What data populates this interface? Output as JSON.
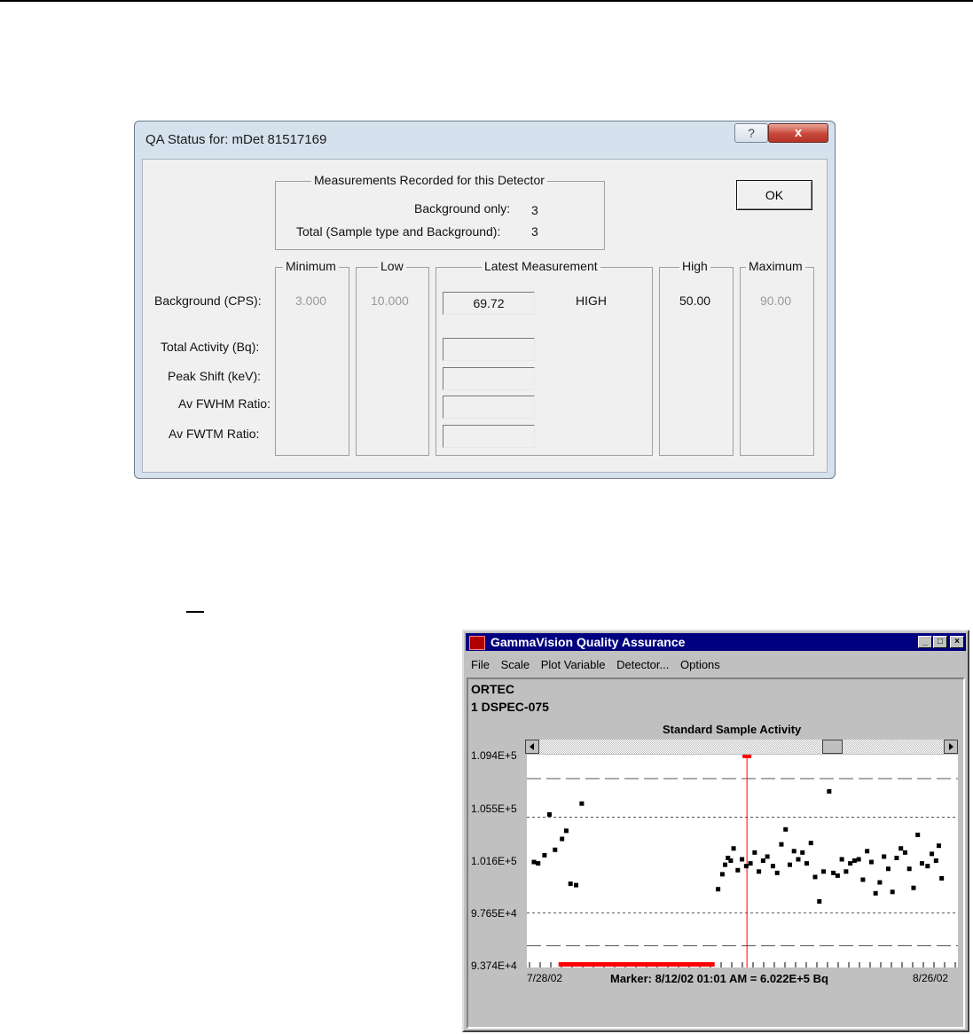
{
  "qa_dialog": {
    "title": "QA Status for: mDet 81517169",
    "help_icon": "?",
    "close_icon": "x",
    "ok_label": "OK",
    "recorded": {
      "caption": "Measurements Recorded for this Detector",
      "background_label": "Background only:",
      "background_value": "3",
      "total_label": "Total (Sample type and Background):",
      "total_value": "3"
    },
    "columns": {
      "minimum": "Minimum",
      "low": "Low",
      "latest": "Latest Measurement",
      "high": "High",
      "maximum": "Maximum"
    },
    "rows": {
      "background": "Background (CPS):",
      "total_activity": "Total Activity (Bq):",
      "peak_shift": "Peak Shift (keV):",
      "av_fwhm": "Av FWHM Ratio:",
      "av_fwtm": "Av FWTM Ratio:"
    },
    "background_values": {
      "minimum": "3.000",
      "low": "10.000",
      "latest": "69.72",
      "status": "HIGH",
      "high": "50.00",
      "maximum": "90.00"
    }
  },
  "gv_window": {
    "title": "GammaVision Quality Assurance",
    "controls": [
      "_",
      "□",
      "×"
    ],
    "menu": [
      "File",
      "Scale",
      "Plot Variable",
      "Detector...",
      "Options"
    ],
    "header_line1": "ORTEC",
    "header_line2": "1 DSPEC-075",
    "marker_text": "Marker: 8/12/02 01:01 AM = 6.022E+5 Bq",
    "colors": {
      "titlebar": "#000080",
      "marker": "#ff0000",
      "plot_bg": "#ffffff"
    }
  },
  "chart_data": {
    "type": "scatter",
    "title": "Standard Sample Activity",
    "y_tick_labels": [
      "1.094E+5",
      "1.055E+5",
      "1.016E+5",
      "9.765E+4",
      "9.374E+4"
    ],
    "ylim": [
      93740,
      109400
    ],
    "x_tick_labels": [
      "7/28/02",
      "8/26/02"
    ],
    "x_range": [
      "7/28/02",
      "8/26/02"
    ],
    "limit_lines": {
      "outer_dashed": [
        107640,
        95340
      ],
      "inner_dotted": [
        104800,
        97760
      ]
    },
    "marker_position": "8/12/02 01:01 AM",
    "series": [
      {
        "x": [
          0,
          0.3,
          0.75,
          1.1,
          1.5,
          2,
          2.3,
          2.6,
          3,
          3.4,
          13.1,
          13.4,
          13.6,
          13.8,
          14,
          14.2,
          14.5,
          14.8,
          15.1,
          15.4,
          15.7,
          16,
          16.3,
          16.6,
          17,
          17.3,
          17.6,
          17.9,
          18.2,
          18.5,
          18.8,
          19.1,
          19.4,
          19.7,
          20,
          20.3,
          20.6,
          21,
          21.3,
          21.6,
          21.9,
          22.2,
          22.5,
          22.8,
          23.1,
          23.4,
          23.7,
          24,
          24.3,
          24.6,
          24.9,
          25.2,
          25.5,
          25.8,
          26.1,
          26.4,
          26.7,
          27,
          27.3,
          27.6,
          28,
          28.3,
          28.6,
          28.8,
          29
        ],
        "y": [
          101500,
          101400,
          102000,
          105000,
          102400,
          103200,
          103800,
          99900,
          99800,
          105800,
          99500,
          100600,
          101300,
          101800,
          101600,
          102500,
          100900,
          101700,
          101200,
          101400,
          102200,
          100800,
          101600,
          101900,
          101200,
          100700,
          102800,
          103900,
          101300,
          102300,
          101700,
          102200,
          101400,
          102900,
          100400,
          98600,
          100800,
          106700,
          100700,
          100500,
          101700,
          100800,
          101400,
          101600,
          101700,
          100200,
          102300,
          101500,
          99200,
          100000,
          101900,
          101000,
          99300,
          101800,
          102500,
          102200,
          101000,
          99600,
          103500,
          101400,
          101200,
          102100,
          101600,
          102700,
          100300
        ]
      }
    ]
  }
}
